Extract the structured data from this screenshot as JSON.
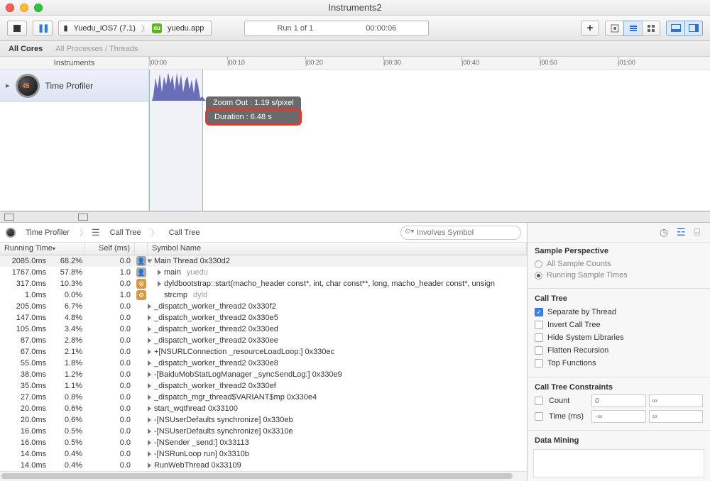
{
  "window": {
    "title": "Instruments2"
  },
  "toolbar": {
    "target_device": "Yuedu_iOS7 (7.1)",
    "target_app": "yuedu.app",
    "run_label": "Run 1 of 1",
    "run_time": "00:00:06"
  },
  "filterbar": {
    "selected": "All Cores",
    "unselected": "All Processes / Threads"
  },
  "timeline": {
    "header_label": "Instruments",
    "ticks": [
      "00:00",
      "00:10",
      "00:20",
      "00:30",
      "00:40",
      "00:50",
      "01:00"
    ],
    "instrument": "Time Profiler",
    "tooltip_zoom": "Zoom Out : 1.19 s/pixel",
    "tooltip_duration": "Duration : 6.48 s"
  },
  "path": {
    "root": "Time Profiler",
    "crumb1": "Call Tree",
    "crumb2": "Call Tree",
    "search_placeholder": "Involves Symbol"
  },
  "columns": {
    "running": "Running Time",
    "self": "Self (ms)",
    "symbol": "Symbol Name"
  },
  "rows": [
    {
      "time": "2085.0ms",
      "pct": "68.2%",
      "self": "0.0",
      "indent": 0,
      "tri": "down",
      "badge": "grey",
      "text": "Main Thread  0x330d2",
      "sel": true
    },
    {
      "time": "1767.0ms",
      "pct": "57.8%",
      "self": "1.0",
      "indent": 1,
      "tri": "right",
      "badge": "grey",
      "text": "main",
      "lib": "yuedu"
    },
    {
      "time": "317.0ms",
      "pct": "10.3%",
      "self": "0.0",
      "indent": 1,
      "tri": "right",
      "badge": "or",
      "text": "dyldbootstrap::start(macho_header const*, int, char const**, long, macho_header const*, unsign"
    },
    {
      "time": "1.0ms",
      "pct": "0.0%",
      "self": "1.0",
      "indent": 1,
      "tri": "",
      "badge": "or",
      "text": "strcmp",
      "lib": "dyld"
    },
    {
      "time": "205.0ms",
      "pct": "6.7%",
      "self": "0.0",
      "indent": 0,
      "tri": "right",
      "badge": "",
      "text": "_dispatch_worker_thread2  0x330f2"
    },
    {
      "time": "147.0ms",
      "pct": "4.8%",
      "self": "0.0",
      "indent": 0,
      "tri": "right",
      "badge": "",
      "text": "_dispatch_worker_thread2  0x330e5"
    },
    {
      "time": "105.0ms",
      "pct": "3.4%",
      "self": "0.0",
      "indent": 0,
      "tri": "right",
      "badge": "",
      "text": "_dispatch_worker_thread2  0x330ed"
    },
    {
      "time": "87.0ms",
      "pct": "2.8%",
      "self": "0.0",
      "indent": 0,
      "tri": "right",
      "badge": "",
      "text": "_dispatch_worker_thread2  0x330ee"
    },
    {
      "time": "67.0ms",
      "pct": "2.1%",
      "self": "0.0",
      "indent": 0,
      "tri": "right",
      "badge": "",
      "text": "+[NSURLConnection _resourceLoadLoop:]  0x330ec"
    },
    {
      "time": "55.0ms",
      "pct": "1.8%",
      "self": "0.0",
      "indent": 0,
      "tri": "right",
      "badge": "",
      "text": "_dispatch_worker_thread2  0x330e8"
    },
    {
      "time": "38.0ms",
      "pct": "1.2%",
      "self": "0.0",
      "indent": 0,
      "tri": "right",
      "badge": "",
      "text": "-[BaiduMobStatLogManager _syncSendLog:]  0x330e9"
    },
    {
      "time": "35.0ms",
      "pct": "1.1%",
      "self": "0.0",
      "indent": 0,
      "tri": "right",
      "badge": "",
      "text": "_dispatch_worker_thread2  0x330ef"
    },
    {
      "time": "27.0ms",
      "pct": "0.8%",
      "self": "0.0",
      "indent": 0,
      "tri": "right",
      "badge": "",
      "text": "_dispatch_mgr_thread$VARIANT$mp  0x330e4"
    },
    {
      "time": "20.0ms",
      "pct": "0.6%",
      "self": "0.0",
      "indent": 0,
      "tri": "right",
      "badge": "",
      "text": "start_wqthread  0x33100"
    },
    {
      "time": "20.0ms",
      "pct": "0.6%",
      "self": "0.0",
      "indent": 0,
      "tri": "right",
      "badge": "",
      "text": "-[NSUserDefaults synchronize]  0x330eb"
    },
    {
      "time": "16.0ms",
      "pct": "0.5%",
      "self": "0.0",
      "indent": 0,
      "tri": "right",
      "badge": "",
      "text": "-[NSUserDefaults synchronize]  0x3310e"
    },
    {
      "time": "16.0ms",
      "pct": "0.5%",
      "self": "0.0",
      "indent": 0,
      "tri": "right",
      "badge": "",
      "text": "-[NSender _send:]  0x33113"
    },
    {
      "time": "14.0ms",
      "pct": "0.4%",
      "self": "0.0",
      "indent": 0,
      "tri": "right",
      "badge": "",
      "text": "-[NSRunLoop run]  0x3310b"
    },
    {
      "time": "14.0ms",
      "pct": "0.4%",
      "self": "0.0",
      "indent": 0,
      "tri": "right",
      "badge": "",
      "text": "RunWebThread  0x33109"
    }
  ],
  "sidebar": {
    "sample_perspective": {
      "title": "Sample Perspective",
      "opt1": "All Sample Counts",
      "opt2": "Running Sample Times"
    },
    "call_tree": {
      "title": "Call Tree",
      "separate": "Separate by Thread",
      "invert": "Invert Call Tree",
      "hide": "Hide System Libraries",
      "flatten": "Flatten Recursion",
      "top": "Top Functions"
    },
    "constraints": {
      "title": "Call Tree Constraints",
      "count": "Count",
      "count_min": "0",
      "count_max": "∞",
      "time": "Time (ms)",
      "time_min": "-∞",
      "time_max": "∞"
    },
    "mining": {
      "title": "Data Mining"
    }
  }
}
